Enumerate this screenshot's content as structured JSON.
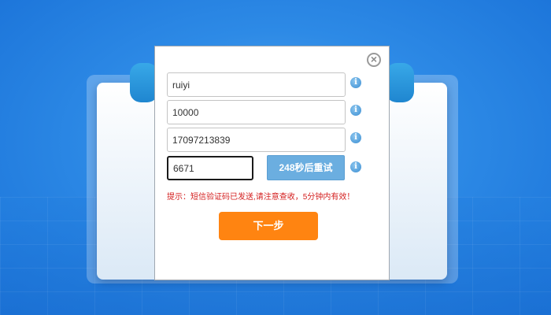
{
  "form": {
    "username_value": "ruiyi",
    "amount_value": "10000",
    "phone_value": "17097213839",
    "code_value": "6671",
    "resend_label": "248秒后重试",
    "hint_text": "提示：短信验证码已发送,请注意查收，5分钟内有效！",
    "next_label": "下一步",
    "info_glyph": "i",
    "close_glyph": "×"
  },
  "colors": {
    "background": "#2d8ae6",
    "next_button": "#ff8411",
    "resend_button": "#6baee0",
    "hint_text": "#d42020"
  },
  "icons": {
    "close": "close-icon",
    "info": "info-icon"
  }
}
